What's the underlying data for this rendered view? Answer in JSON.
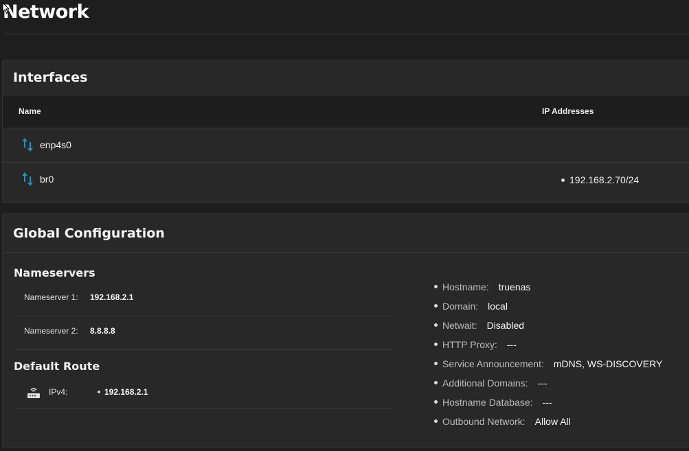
{
  "page": {
    "title": "Network"
  },
  "interfaces": {
    "title": "Interfaces",
    "columns": {
      "name": "Name",
      "ip": "IP Addresses"
    },
    "rows": [
      {
        "name": "enp4s0",
        "ip": ""
      },
      {
        "name": "br0",
        "ip": "192.168.2.70/24"
      }
    ]
  },
  "global": {
    "title": "Global Configuration",
    "nameservers": {
      "title": "Nameservers",
      "items": [
        {
          "label": "Nameserver 1:",
          "value": "192.168.2.1"
        },
        {
          "label": "Nameserver 2:",
          "value": "8.8.8.8"
        }
      ]
    },
    "default_route": {
      "title": "Default Route",
      "label": "IPv4:",
      "value": "192.168.2.1"
    },
    "info": [
      {
        "label": "Hostname:",
        "value": "truenas"
      },
      {
        "label": "Domain:",
        "value": "local"
      },
      {
        "label": "Netwait:",
        "value": "Disabled"
      },
      {
        "label": "HTTP Proxy:",
        "value": "---"
      },
      {
        "label": "Service Announcement:",
        "value": "mDNS, WS-DISCOVERY"
      },
      {
        "label": "Additional Domains:",
        "value": "---"
      },
      {
        "label": "Hostname Database:",
        "value": "---"
      },
      {
        "label": "Outbound Network:",
        "value": "Allow All"
      }
    ]
  },
  "colors": {
    "background": "#1e1e1e",
    "card": "#282828",
    "icon": "#2f8db3"
  }
}
